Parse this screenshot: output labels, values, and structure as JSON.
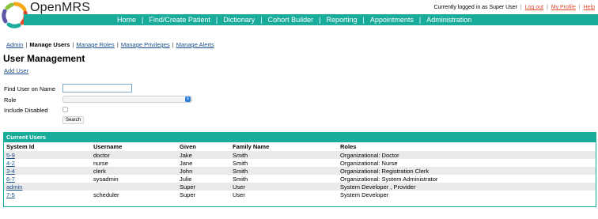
{
  "brand": {
    "name": "OpenMRS",
    "colors": {
      "teal": "#1aac9b",
      "link": "#1a4f8b",
      "user_link": "#e0492b"
    }
  },
  "userbar": {
    "logged_in_text": "Currently logged in as Super User",
    "links": [
      "Log out",
      "My Profile",
      "Help"
    ]
  },
  "nav": [
    "Home",
    "Find/Create Patient",
    "Dictionary",
    "Cohort Builder",
    "Reporting",
    "Appointments",
    "Administration"
  ],
  "subnav": {
    "admin": "Admin",
    "manage_users": "Manage Users",
    "manage_roles": "Manage Roles",
    "manage_privileges": "Manage Privileges",
    "manage_alerts": "Manage Alerts"
  },
  "page": {
    "title": "User Management",
    "add_user": "Add User"
  },
  "search_form": {
    "name_label": "Find User on Name",
    "name_value": "",
    "role_label": "Role",
    "role_selected": "",
    "include_disabled_label": "Include Disabled",
    "include_disabled_checked": false,
    "search_button": "Search"
  },
  "users": {
    "header": "Current Users",
    "columns": [
      "System Id",
      "Username",
      "Given",
      "Family Name",
      "Roles"
    ],
    "rows": [
      {
        "system_id": "5-9",
        "username": "doctor",
        "given": "Jake",
        "family": "Smith",
        "roles": "Organizational: Doctor"
      },
      {
        "system_id": "4-2",
        "username": "nurse",
        "given": "Jane",
        "family": "Smith",
        "roles": "Organizational: Nurse"
      },
      {
        "system_id": "3-4",
        "username": "clerk",
        "given": "John",
        "family": "Smith",
        "roles": "Organizational: Registration Clerk"
      },
      {
        "system_id": "6-7",
        "username": "sysadmin",
        "given": "Julie",
        "family": "Smith",
        "roles": "Organizational: System Administrator"
      },
      {
        "system_id": "admin",
        "username": "",
        "given": "Super",
        "family": "User",
        "roles": "System Developer , Provider"
      },
      {
        "system_id": "7-5",
        "username": "scheduler",
        "given": "Super",
        "family": "User",
        "roles": "System Developer"
      }
    ]
  }
}
